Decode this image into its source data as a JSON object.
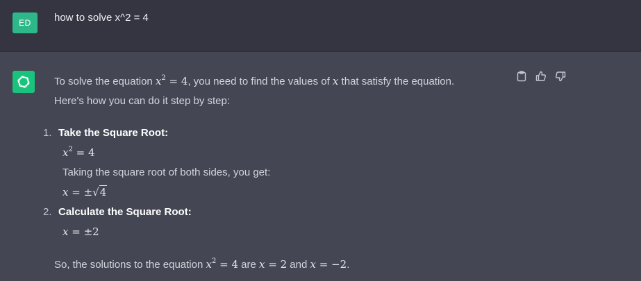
{
  "user": {
    "avatar_initials": "ED",
    "message": "how to solve x^2 = 4"
  },
  "assistant": {
    "intro_1": "To solve the equation ",
    "intro_eq_base": "x",
    "intro_eq_exp": "2",
    "intro_eq_rest": " = 4",
    "intro_2": ", you need to find the values of ",
    "intro_var": "x",
    "intro_3": " that satisfy the equation.",
    "intro_line2": "Here's how you can do it step by step:",
    "steps": [
      {
        "num": "1.",
        "title": "Take the Square Root:",
        "eq1_base": "x",
        "eq1_exp": "2",
        "eq1_rest": " = 4",
        "text": "Taking the square root of both sides, you get:",
        "eq2_var": "x",
        "eq2_rest": " = ±",
        "eq2_rad": "4"
      },
      {
        "num": "2.",
        "title": "Calculate the Square Root:",
        "eq_var": "x",
        "eq_rest": " = ±2"
      }
    ],
    "summary_1": "So, the solutions to the equation ",
    "summary_eq_base": "x",
    "summary_eq_exp": "2",
    "summary_eq_rest": " = 4",
    "summary_2": " are ",
    "summary_sol1_var": "x",
    "summary_sol1_rest": " = 2",
    "summary_3": " and ",
    "summary_sol2_var": "x",
    "summary_sol2_rest": " = −2",
    "summary_4": "."
  },
  "actions": {
    "copy_icon": "clipboard-icon",
    "like_icon": "thumbs-up-icon",
    "dislike_icon": "thumbs-down-icon"
  },
  "colors": {
    "user_bg": "#343541",
    "assistant_bg": "#444654",
    "user_avatar": "#2eb889",
    "bot_avatar": "#19c37d"
  }
}
